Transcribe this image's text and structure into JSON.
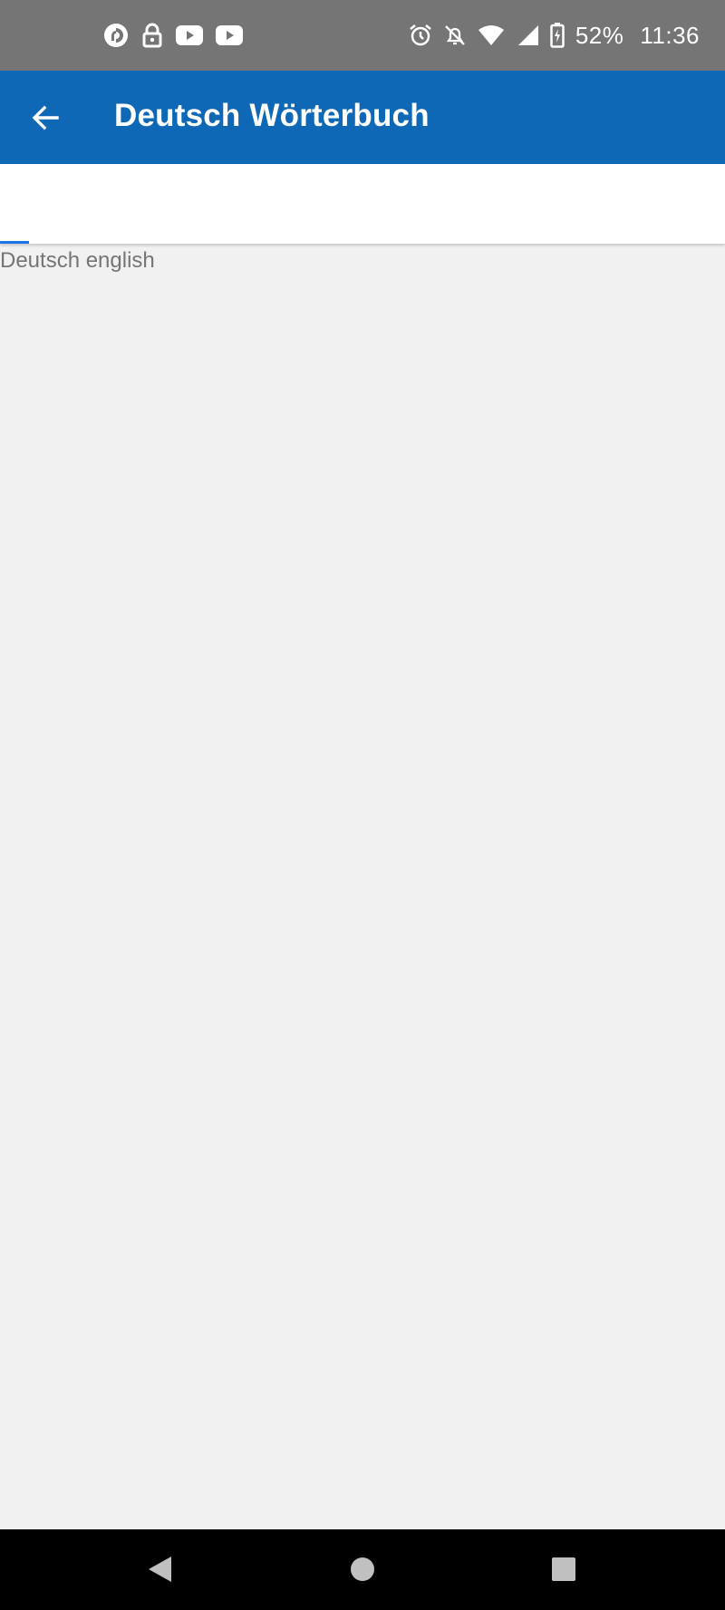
{
  "status_bar": {
    "left_icons": [
      "pocket-casts-icon",
      "lock-icon",
      "youtube-icon",
      "youtube-icon"
    ],
    "right_icons": [
      "alarm-icon",
      "notifications-off-icon",
      "wifi-icon",
      "signal-icon",
      "battery-charging-icon"
    ],
    "battery": "52%",
    "time": "11:36"
  },
  "app_bar": {
    "title": "Deutsch Wörterbuch",
    "back_icon": "arrow-back-icon",
    "color": "#0e68b6"
  },
  "page": {
    "progress_fraction": 0.04,
    "progress_color": "#1a73e8",
    "text": "Deutsch english"
  },
  "nav_bar": {
    "icons": [
      "back-triangle-icon",
      "home-circle-icon",
      "recents-square-icon"
    ]
  }
}
